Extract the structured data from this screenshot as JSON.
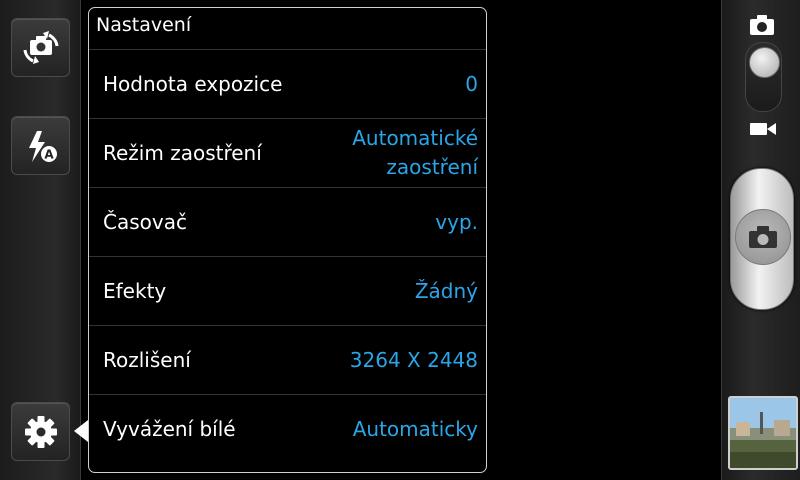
{
  "panel": {
    "title": "Nastavení",
    "rows": [
      {
        "label": "Hodnota expozice",
        "value": "0"
      },
      {
        "label": "Režim zaostření",
        "value": "Automatické zaostření"
      },
      {
        "label": "Časovač",
        "value": "vyp."
      },
      {
        "label": "Efekty",
        "value": "Žádný"
      },
      {
        "label": "Rozlišení",
        "value": "3264 X 2448"
      },
      {
        "label": "Vyvážení bílé",
        "value": "Automaticky"
      }
    ]
  },
  "icons": {
    "left_rail": [
      "switch-camera-icon",
      "flash-auto-icon",
      "settings-gear-icon"
    ],
    "right_rail": [
      "photo-mode-icon",
      "video-mode-icon",
      "shutter-camera-icon"
    ]
  },
  "colors": {
    "accent": "#2aa6e8",
    "panel_border": "#cfcfcf",
    "background": "#000000"
  }
}
